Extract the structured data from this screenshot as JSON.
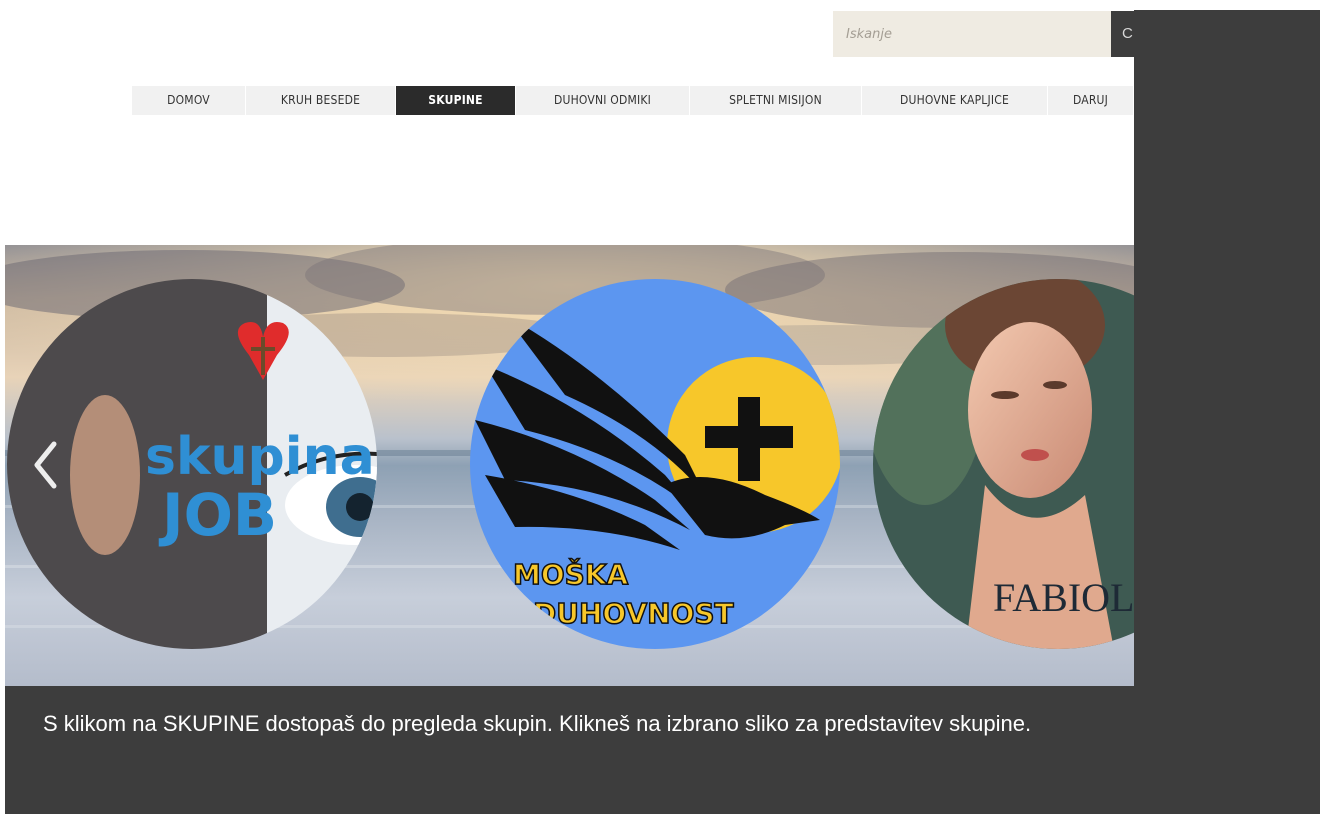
{
  "search": {
    "placeholder": "Iskanje",
    "button_label": "C"
  },
  "nav": {
    "items": [
      {
        "label": "DOMOV"
      },
      {
        "label": "KRUH BESEDE"
      },
      {
        "label": "SKUPINE"
      },
      {
        "label": "DUHOVNI ODMIKI"
      },
      {
        "label": "SPLETNI MISIJON"
      },
      {
        "label": "DUHOVNE KAPLJICE"
      },
      {
        "label": "DARUJ"
      }
    ],
    "active": "SKUPINE"
  },
  "slider": {
    "slides": [
      {
        "line1": "skupina",
        "line2": "JOB"
      },
      {
        "line1": "MOŠKA",
        "line2": "DUHOVNOST"
      },
      {
        "line1": "FABIOLA"
      }
    ],
    "prev_icon": "chevron-left-icon"
  },
  "caption": {
    "text": "S klikom na SKUPINE dostopaš do pregleda skupin. Klikneš na izbrano sliko za predstavitev skupine."
  },
  "colors": {
    "dark_panel": "#3d3d3d",
    "nav_bg": "#f1f1f1",
    "nav_active": "#2b2b2b",
    "search_bg": "#efebe2",
    "logo_blue": "#5c96f0",
    "logo_yellow": "#f7c72a"
  }
}
